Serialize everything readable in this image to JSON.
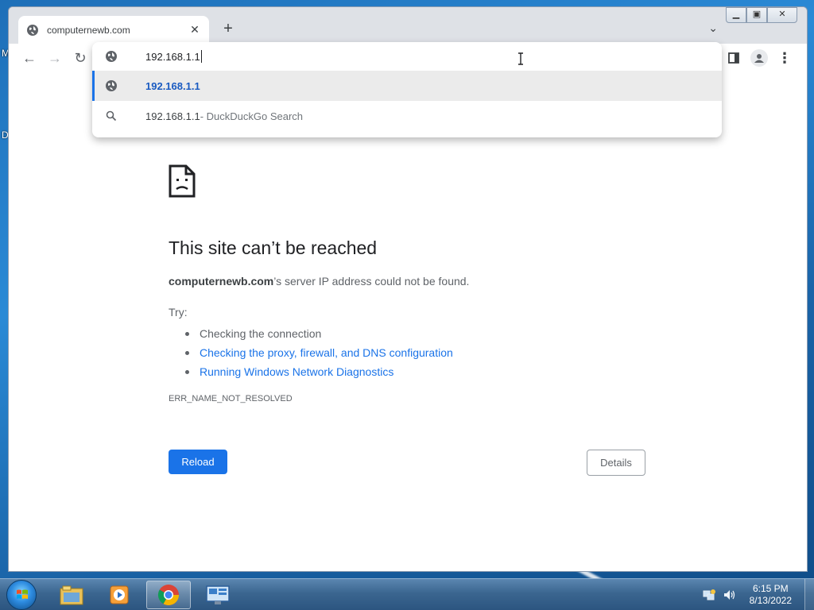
{
  "desktop": {
    "edge_letters": [
      "M",
      "D"
    ]
  },
  "browser": {
    "tab": {
      "title": "computernewb.com",
      "close_glyph": "✕"
    },
    "new_tab_glyph": "+",
    "tab_search_glyph": "⌄",
    "window_controls": {
      "minimize": "▁",
      "maximize": "▣",
      "close": "✕"
    },
    "nav": {
      "back": "←",
      "forward": "→",
      "reload": "↻"
    },
    "menu_glyph": "⋮"
  },
  "omnibox": {
    "input_value": "192.168.1.1",
    "suggestions": [
      {
        "icon": "globe-icon",
        "text": "192.168.1.1",
        "suffix": "",
        "selected": true
      },
      {
        "icon": "search-icon",
        "text": "192.168.1.1",
        "suffix": " - DuckDuckGo Search",
        "selected": false
      }
    ]
  },
  "error_page": {
    "title": "This site can’t be reached",
    "host": "computernewb.com",
    "desc_suffix": "’s server IP address could not be found.",
    "try_label": "Try:",
    "suggestions": [
      {
        "text": "Checking the connection",
        "link": false
      },
      {
        "text": "Checking the proxy, firewall, and DNS configuration",
        "link": true
      },
      {
        "text": "Running Windows Network Diagnostics",
        "link": true
      }
    ],
    "error_code": "ERR_NAME_NOT_RESOLVED",
    "reload_label": "Reload",
    "details_label": "Details"
  },
  "taskbar": {
    "apps": [
      "explorer-icon",
      "media-player-icon",
      "chrome-icon",
      "remote-desktop-icon"
    ],
    "active_app": "chrome-icon",
    "clock": {
      "time": "6:15 PM",
      "date": "8/13/2022"
    }
  },
  "colors": {
    "accent": "#1a73e8",
    "link": "#1a73e8",
    "taskbar": "#3b6690"
  }
}
